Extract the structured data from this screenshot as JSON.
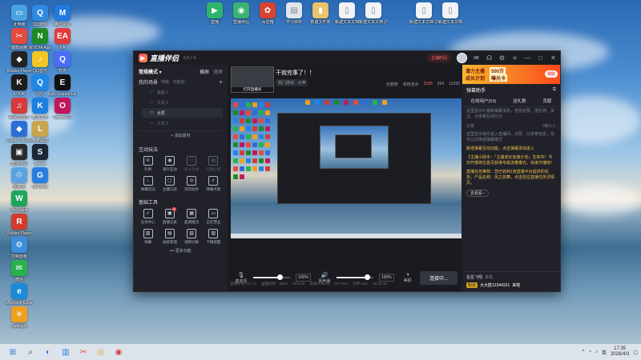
{
  "desktop": {
    "icons": [
      {
        "label": "此电脑",
        "color": "#4aa3df",
        "glyph": "▭"
      },
      {
        "label": "一键截图精灵",
        "color": "#e64a3c",
        "glyph": "✂"
      },
      {
        "label": "Roblox Player",
        "color": "#222222",
        "glyph": "◆"
      },
      {
        "label": "KOOK",
        "color": "#1c1c1c",
        "glyph": "K"
      },
      {
        "label": "网易云音乐",
        "color": "#d63a3a",
        "glyph": "♫"
      },
      {
        "label": "Roblox Studio",
        "color": "#2b6fd6",
        "glyph": "◆"
      },
      {
        "label": "直播伴侣",
        "color": "#2a2a2a",
        "glyph": "▣"
      },
      {
        "label": "回收站",
        "color": "#5ba3e0",
        "glyph": "♲"
      },
      {
        "label": "WeGame",
        "color": "#1ea55c",
        "glyph": "W"
      },
      {
        "label": "Roblox Player",
        "color": "#d43b2c",
        "glyph": "R"
      },
      {
        "label": "控制面板",
        "color": "#3d8edb",
        "glyph": "⚙"
      },
      {
        "label": "微信",
        "color": "#28b24b",
        "glyph": "✉"
      },
      {
        "label": "Microsoft Edge",
        "color": "#1b8ad8",
        "glyph": "e"
      },
      {
        "label": "Sunlogin",
        "color": "#f0a020",
        "glyph": "☀"
      },
      {
        "label": "QQ游戏",
        "color": "#2d8ae0",
        "glyph": "Q"
      },
      {
        "label": "NVIDIA App",
        "color": "#1f8a25",
        "glyph": "N"
      },
      {
        "label": "QQ音乐",
        "color": "#f3c623",
        "glyph": "♪"
      },
      {
        "label": "QQ",
        "color": "#1e88e5",
        "glyph": "Q"
      },
      {
        "label": "酷狗音乐",
        "color": "#1d7fe0",
        "glyph": "K"
      },
      {
        "label": "英雄联盟",
        "color": "#c8a44a",
        "glyph": "L"
      },
      {
        "label": "Steam",
        "color": "#1b2838",
        "glyph": "S"
      },
      {
        "label": "GeForce",
        "color": "#2a7de1",
        "glyph": "G"
      },
      {
        "label": "腾讯会议",
        "color": "#2279e0",
        "glyph": "M"
      },
      {
        "label": "EA",
        "color": "#e23b3b",
        "glyph": "EA"
      },
      {
        "label": "夸克",
        "color": "#4b6cf5",
        "glyph": "Q"
      },
      {
        "label": "Epic Games Launcher",
        "color": "#111111",
        "glyph": "E"
      },
      {
        "label": "Opera GX",
        "color": "#c2185b",
        "glyph": "O"
      }
    ],
    "top_icons": [
      {
        "label": "直播",
        "color": "#2db56b",
        "glyph": "▶"
      },
      {
        "label": "直播伴侣",
        "color": "#3cb371",
        "glyph": "◉"
      },
      {
        "label": "百宝箱",
        "color": "#d94332",
        "glyph": "✿"
      },
      {
        "label": "学习资料",
        "color": "#dfe6ee",
        "glyph": "▤"
      },
      {
        "label": "新建文件夹",
        "color": "#e9c46a",
        "glyph": "▮"
      },
      {
        "label": "新建文本文档",
        "color": "#f1f3f6",
        "glyph": "▯"
      },
      {
        "label": "新建文本文档 (2)",
        "color": "#f1f3f6",
        "glyph": "▯"
      },
      {
        "label": "新建文本文档 (3)",
        "color": "#f1f3f6",
        "glyph": "▯"
      },
      {
        "label": "新建文本文档",
        "color": "#f1f3f6",
        "glyph": "▯"
      }
    ]
  },
  "app": {
    "name": "直播伴侣",
    "version": "6.5.7.4",
    "schedule_btn": "主播时间",
    "left": {
      "mode": "常规模式 ▾",
      "edit": "横屏",
      "fullscreen": "竖屏",
      "my_scenes": "我的场景",
      "scene_sub": "电脑 · 可拖动",
      "sources": [
        "画面 1",
        "文本 1",
        "全屏",
        "文本 2"
      ],
      "add_source": "+ 添加素材",
      "interact_title": "互动玩法",
      "interact": [
        {
          "label": "礼物",
          "dim": false
        },
        {
          "label": "观众互动",
          "dim": false
        },
        {
          "label": "多人连线",
          "dim": true
        },
        {
          "label": "礼物公屏",
          "dim": true
        },
        {
          "label": "弹幕玩法",
          "dim": false
        },
        {
          "label": "主播口袋",
          "dim": false
        },
        {
          "label": "玩玩助手",
          "dim": false
        },
        {
          "label": "弹幕点歌",
          "dim": false
        }
      ],
      "tools_title": "基础工具",
      "tools": [
        {
          "label": "任务中心",
          "badge": ""
        },
        {
          "label": "直播记录",
          "badge": "1"
        },
        {
          "label": "超清推流",
          "badge": ""
        },
        {
          "label": "正在营业",
          "badge": ""
        },
        {
          "label": "弹幕",
          "badge": ""
        },
        {
          "label": "录屏管理",
          "badge": ""
        },
        {
          "label": "视频切换",
          "badge": ""
        },
        {
          "label": "下播提醒",
          "badge": ""
        }
      ],
      "more": "••• 更多功能"
    },
    "center": {
      "room_title": "干就完事了！！",
      "thumb_caption": "打开直播间",
      "category": "热门游戏 · 大神",
      "stats": [
        "全部榜",
        "考核流水",
        "2195",
        "594",
        "16292"
      ],
      "audio": {
        "mic_label": "麦克风",
        "mic_pct": "100%",
        "mic_level": 0.72,
        "spk_label": "扬声器",
        "spk_pct": "100%",
        "spk_level": 0.84,
        "buttons": [
          "美颜",
          "录制",
          "设置"
        ]
      },
      "go_live": "连接中...",
      "status": [
        "直播伴侣 6.5.7.4",
        "画面码率：0kb/s",
        "FPS:60",
        "丢帧(0.00%)",
        "CPU:6%",
        "内存:11%",
        "19:32:35"
      ]
    },
    "right": {
      "banner": [
        "潜力主播",
        "成长计划",
        "500万",
        "曝光卡",
        "领取"
      ],
      "assistant_title": "弹幕助手",
      "tabs": [
        "在线用户(53)",
        "送礼数",
        "贡献"
      ],
      "msgs": [
        "这里显示礼物和弹幕消息，包括点赞、送礼物、关注、分享等互动行为",
        "这里显示观众进入直播间、点赞、分享等信息，也可以切换成弹幕模式",
        "欢迎来到直播间！"
      ],
      "notify_head": [
        "公告",
        "0条/1人"
      ],
      "notify_text": "新增弹幕互动功能，点击弹幕添加进入",
      "notice": "【主播小助手：「主播成长加速计划」生效中！今日开播将在首页获得专属流量曝光，快来开播吧！",
      "task_text": "直播任务推荐：您已收到1张直播平台提供的任务，产品名称：风之剑舞，点击前往直播任务详情页。",
      "view_btn": "去看看 ›",
      "chat_name": "星星飞翔",
      "chat_role": "来啦",
      "chat_lvl": "粉丝",
      "chat_user": "大大胜12344321",
      "chat_tail": "来啦"
    }
  },
  "taskbar": {
    "time": "17:35",
    "date": "2026/4/3",
    "lang": "英"
  }
}
